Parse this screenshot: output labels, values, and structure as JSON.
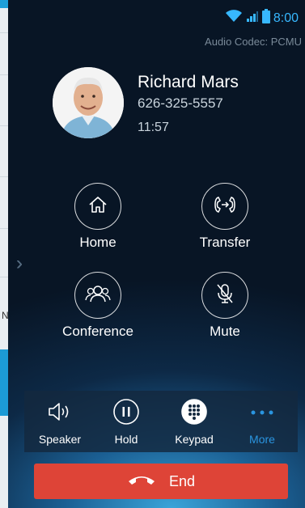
{
  "status": {
    "time": "8:00"
  },
  "call": {
    "codec": "Audio Codec: PCMU",
    "contact_name": "Richard Mars",
    "phone_number": "626-325-5557",
    "duration": "11:57"
  },
  "actions": [
    {
      "label": "Home",
      "icon": "home-icon"
    },
    {
      "label": "Transfer",
      "icon": "transfer-icon"
    },
    {
      "label": "Conference",
      "icon": "conference-icon"
    },
    {
      "label": "Mute",
      "icon": "microphone-icon"
    }
  ],
  "bottom_bar": [
    {
      "label": "Speaker",
      "icon": "speaker-icon"
    },
    {
      "label": "Hold",
      "icon": "pause-icon"
    },
    {
      "label": "Keypad",
      "icon": "keypad-icon"
    },
    {
      "label": "More",
      "icon": "more-icon"
    }
  ],
  "end_button": {
    "label": "End"
  },
  "background_app": {
    "label": "N"
  },
  "colors": {
    "accent": "#2a95e0",
    "end": "#de4437",
    "time": "#37b8ff"
  }
}
